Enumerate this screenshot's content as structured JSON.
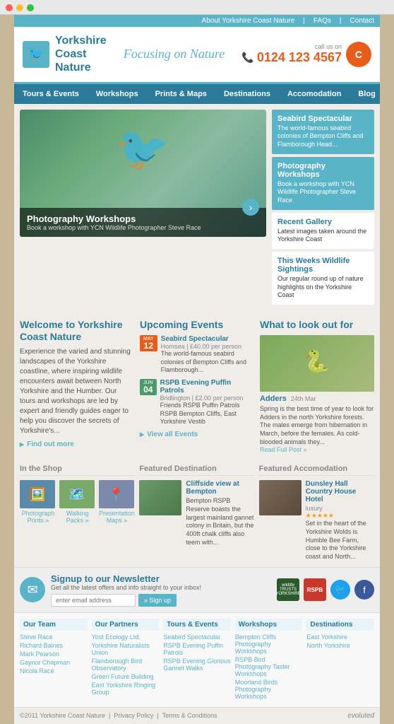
{
  "browser": {
    "dots": [
      "red",
      "yellow",
      "green"
    ]
  },
  "top_bar": {
    "links": [
      "About Yorkshire Coast Nature",
      "FAQs",
      "Contact"
    ]
  },
  "header": {
    "logo_line1": "Yorkshire",
    "logo_line2": "Coast",
    "logo_line3": "Nature",
    "tagline": "Focusing on Nature",
    "call_us_label": "call us on",
    "phone": "0124 123 4567"
  },
  "nav": {
    "items": [
      "Tours & Events",
      "Workshops",
      "Prints & Maps",
      "Destinations",
      "Accomodation",
      "Blog"
    ]
  },
  "hero": {
    "caption_title": "Photography Workshops",
    "caption_sub": "Book a workshop with YCN Wildlife Photographer Steve Race"
  },
  "sidebar": {
    "cards": [
      {
        "title": "Seabird Spectacular",
        "text": "The world-famous seabird colonies of Bempton Cliffs and Flamborough Head...",
        "type": "teal"
      },
      {
        "title": "Photography Workshops",
        "text": "Book a workshop with YCN Wildlife Photographer Sleve Race",
        "type": "teal"
      },
      {
        "title": "Recent Gallery",
        "text": "Latest images taken around the Yorkshire Coast",
        "type": "white"
      },
      {
        "title": "This Weeks Wildlife Sightings",
        "text": "Our regular round up of nature highlights on the Yorkshire Coast",
        "type": "white"
      }
    ]
  },
  "welcome": {
    "title": "Welcome to Yorkshire Coast Nature",
    "text": "Experience the varied and stunning landscapes of the Yorkshire coastline, where inspiring wildlife encounters await between North Yorkshire and the Humber. Our tours and workshops are led by expert and friendly guides eager to help you discover the secrets of Yorkshire's...",
    "find_out_more": "Find out more"
  },
  "events": {
    "title": "Upcoming Events",
    "items": [
      {
        "month": "MAY",
        "day": "12",
        "title": "Seabird Spectacular",
        "location": "Hornsea  |  £40.00 per person",
        "desc": "The world-famous seabird colonies of Bempton Cliffs and Flamborough...",
        "color": "orange"
      },
      {
        "month": "JUN",
        "day": "04",
        "title": "RSPB Evening Puffin Patrols",
        "location": "Bridlington  |  £2.00 per person",
        "desc": "Friends RSPB Puffin Patrols RSPB Bempton Cliffs, East Yorkshire Vestib",
        "color": "green"
      }
    ],
    "view_all": "View all Events"
  },
  "wildlife": {
    "title": "What to look out for",
    "creature": "Adders",
    "date": "24th Mar",
    "text": "Spring is the best time of year to look for Adders in the north Yorkshire forests. The males emerge from hibernation in March, before the females. As cold-blooded animals they...",
    "read_full": "Read Full Post »"
  },
  "shop": {
    "title": "In the Shop",
    "items": [
      {
        "label": "Photograph\nPrints »",
        "emoji": "🖼️",
        "bg": "#5a8aaa"
      },
      {
        "label": "Walking\nPacks »",
        "emoji": "🗺️",
        "bg": "#7aaa6a"
      },
      {
        "label": "Presentation\nMaps »",
        "emoji": "📍",
        "bg": "#7a8aaa"
      }
    ]
  },
  "featured_dest": {
    "title": "Featured Destination",
    "name": "Cliffside view at Bempton",
    "desc": "Bempton RSPB Reserve boasts the largest mainland gannet colony in Britain, but the 400ft chalk cliffs also teem with...",
    "bg": "#6a9a6a"
  },
  "featured_accom": {
    "title": "Featured Accomodation",
    "name": "Dunsley Hall Country House Hotel",
    "rating": "★★★★★",
    "rating_note": "luxury",
    "desc": "Set in the heart of the Yorkshire Wolds is Humble Bee Farm, close to the Yorkshire coast and North...",
    "bg": "#7a6a5a"
  },
  "newsletter": {
    "title": "Signup to our Newsletter",
    "subtitle": "Get all the latest offers and info straight to your inbox!",
    "placeholder": "enter email address",
    "button": "» Sign up"
  },
  "social": {
    "twitter_label": "Twitter",
    "facebook_label": "Facebook"
  },
  "footer_cols": [
    {
      "title": "Our Team",
      "links": [
        "Steve Race",
        "Richard Baines",
        "Mark Pearson",
        "Gaynor Chapman",
        "Nicola Race"
      ]
    },
    {
      "title": "Our Partners",
      "links": [
        "Yost Ecology Ltd.",
        "Yorkshire Naturalists Union",
        "Flamborough Bird Observatory",
        "Green Future Building",
        "East Yorkshire Ringing Group"
      ]
    },
    {
      "title": "Tours & Events",
      "links": [
        "Seabird Spectacular",
        "RSPB Evening Puffin Patrols",
        "RSPB Evening Glorious Gannet Walks"
      ]
    },
    {
      "title": "Workshops",
      "links": [
        "Bempton Cliffs Photography Workshops",
        "RSPB Bird Photography Taster Workshops",
        "Moorland Birds Photography Workshops"
      ]
    },
    {
      "title": "Destinations",
      "links": [
        "East Yorkshire",
        "North Yorkshire"
      ]
    }
  ],
  "bottom_footer": {
    "copyright": "©2011 Yorkshire Coast Nature",
    "privacy": "Privacy Policy",
    "terms": "Terms & Conditions",
    "agency": "evoluted"
  }
}
